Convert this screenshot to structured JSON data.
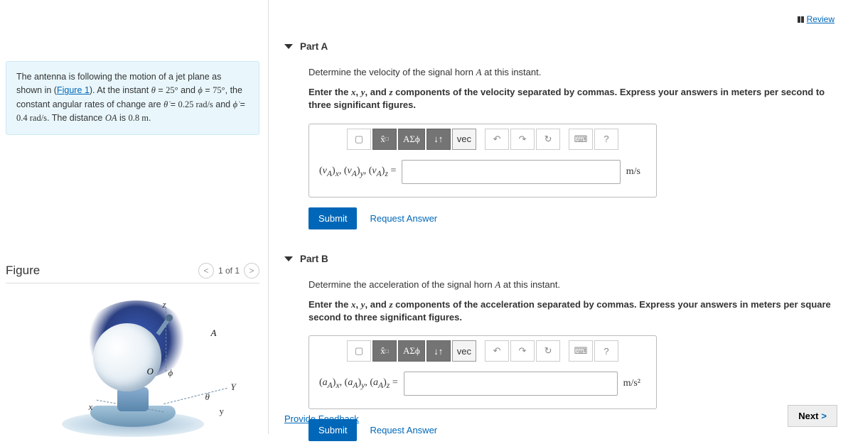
{
  "review": {
    "label": "Review"
  },
  "problem": {
    "line1_a": "The antenna is following the motion of a jet plane as shown in (",
    "figlink": "Figure 1",
    "line1_b": "). At the instant ",
    "theta": "θ",
    "eq": " = ",
    "thetaVal": "25°",
    "and1": " and ",
    "phi": "ϕ",
    "phiVal": "75°",
    "line1_c": ", the constant angular rates of change are ",
    "thetadot": "θ̇",
    "thetadotVal": "0.25 rad/s",
    "and2": " and ",
    "phidot": "ϕ̇",
    "phidotVal": "0.4 rad/s",
    "line1_d": ". The distance ",
    "OA": "OA",
    "is": " is ",
    "dist": "0.8 m",
    "period": "."
  },
  "figure": {
    "title": "Figure",
    "counter": "1 of 1",
    "labels": {
      "z": "z",
      "A": "A",
      "Y": "Y",
      "y": "y",
      "x": "x",
      "O": "O",
      "phi": "ϕ",
      "theta": "θ"
    }
  },
  "partA": {
    "title": "Part A",
    "q": "Determine the velocity of the signal horn A at this instant.",
    "instr": "Enter the x, y, and z components of the velocity separated by commas. Express your answers in meters per second to three significant figures.",
    "varLabel": "(v_A)_x, (v_A)_y, (v_A)_z =",
    "unit": "m/s",
    "submit": "Submit",
    "request": "Request Answer"
  },
  "partB": {
    "title": "Part B",
    "q": "Determine the acceleration of the signal horn A at this instant.",
    "instr": "Enter the x, y, and z components of the acceleration separated by commas. Express your answers in meters per square second to three significant figures.",
    "varLabel": "(a_A)_x, (a_A)_y, (a_A)_z =",
    "unit": "m/s²",
    "submit": "Submit",
    "request": "Request Answer"
  },
  "toolbar": {
    "templ": "▢",
    "sqrt": "√",
    "greek": "ΑΣϕ",
    "scripts": "↓↑",
    "vec": "vec",
    "undo": "↶",
    "redo": "↷",
    "reset": "↻",
    "keyboard": "⌨",
    "help": "?"
  },
  "feedback": "Provide Feedback",
  "next": "Next"
}
